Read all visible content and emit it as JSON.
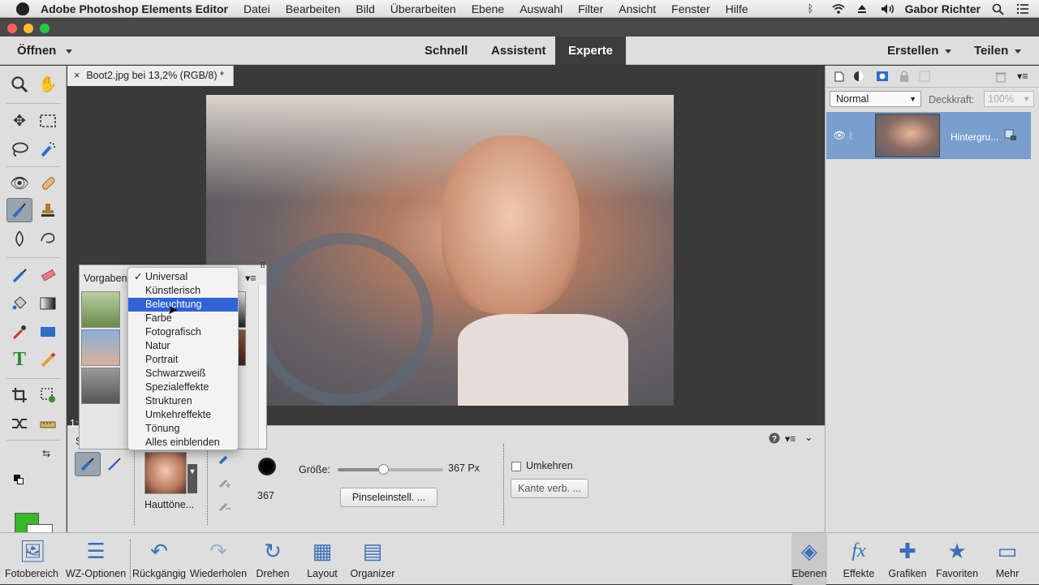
{
  "menubar": {
    "app": "Adobe Photoshop Elements Editor",
    "items": [
      "Datei",
      "Bearbeiten",
      "Bild",
      "Überarbeiten",
      "Ebene",
      "Auswahl",
      "Filter",
      "Ansicht",
      "Fenster",
      "Hilfe"
    ],
    "user": "Gabor Richter"
  },
  "topbar": {
    "open": "Öffnen",
    "modes": [
      "Schnell",
      "Assistent",
      "Experte"
    ],
    "active_mode": "Experte",
    "create": "Erstellen",
    "share": "Teilen"
  },
  "document": {
    "tab_title": "Boot2.jpg bei 13,2% (RGB/8) *",
    "close": "×"
  },
  "layers": {
    "blend_mode": "Normal",
    "opacity_label": "Deckkraft:",
    "opacity_value": "100%",
    "layer_name": "Hintergru..."
  },
  "presets": {
    "title": "Vorgaben",
    "preset_label": "Hauttöne...",
    "menu": [
      "Universal",
      "Künstlerisch",
      "Beleuchtung",
      "Farbe",
      "Fotografisch",
      "Natur",
      "Portrait",
      "Schwarzweiß",
      "Spezialeffekte",
      "Strukturen",
      "Umkehreffekte",
      "Tönung",
      "Alles einblenden"
    ],
    "checked": "Universal",
    "highlighted": "Beleuchtung",
    "status_prefix": "1:",
    "s_prefix": "S"
  },
  "options": {
    "size_label": "Größe:",
    "size_value": "367 Px",
    "size_fraction": 0.43,
    "brush_number": "367",
    "brush_settings": "Pinseleinstell. ...",
    "invert": "Umkehren",
    "refine_edge": "Kante verb. ..."
  },
  "bottombar": {
    "left": [
      {
        "label": "Fotobereich",
        "icon": "photo-bin-icon"
      },
      {
        "label": "WZ-Optionen",
        "icon": "tool-options-icon"
      },
      {
        "label": "Rückgängig",
        "icon": "undo-icon"
      },
      {
        "label": "Wiederholen",
        "icon": "redo-icon"
      },
      {
        "label": "Drehen",
        "icon": "rotate-icon"
      },
      {
        "label": "Layout",
        "icon": "layout-icon"
      },
      {
        "label": "Organizer",
        "icon": "organizer-icon"
      }
    ],
    "right": [
      {
        "label": "Ebenen",
        "icon": "layers-icon"
      },
      {
        "label": "Effekte",
        "icon": "fx-icon"
      },
      {
        "label": "Grafiken",
        "icon": "plus-icon"
      },
      {
        "label": "Favoriten",
        "icon": "star-icon"
      },
      {
        "label": "Mehr",
        "icon": "more-icon"
      }
    ]
  },
  "colors": {
    "foreground": "#39b82a",
    "background": "#ffffff",
    "active_mode_bg": "#3d3d3d",
    "menu_highlight": "#2f63d6",
    "layer_selected": "#7a9fcf",
    "icon_blue": "#3b6fb8"
  }
}
